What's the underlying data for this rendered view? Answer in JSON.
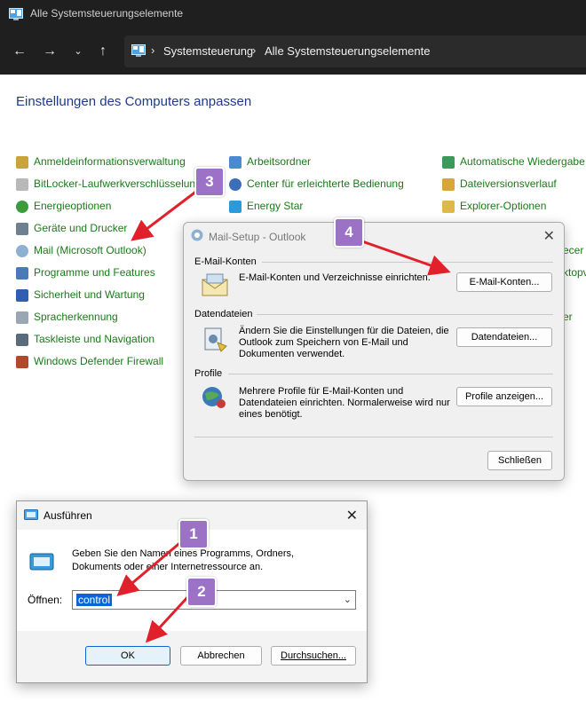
{
  "window": {
    "title": "Alle Systemsteuerungselemente",
    "breadcrumb": [
      "Systemsteuerung",
      "Alle Systemsteuerungselemente"
    ]
  },
  "content": {
    "heading": "Einstellungen des Computers anpassen",
    "col1": [
      {
        "label": "Anmeldeinformationsverwaltung",
        "icon": "credential-icon"
      },
      {
        "label": "BitLocker-Laufwerkverschlüsselun",
        "icon": "bitlocker-icon"
      },
      {
        "label": "Energieoptionen",
        "icon": "power-icon"
      },
      {
        "label": "Geräte und Drucker",
        "icon": "printer-icon"
      },
      {
        "label": "Mail (Microsoft Outlook)",
        "icon": "mail-icon"
      },
      {
        "label": "Programme und Features",
        "icon": "programs-icon"
      },
      {
        "label": "Sicherheit und Wartung",
        "icon": "flag-icon"
      },
      {
        "label": "Spracherkennung",
        "icon": "microphone-icon"
      },
      {
        "label": "Taskleiste und Navigation",
        "icon": "taskbar-icon"
      },
      {
        "label": "Windows Defender Firewall",
        "icon": "firewall-icon"
      }
    ],
    "col2": [
      {
        "label": "Arbeitsordner",
        "icon": "work-folder-icon"
      },
      {
        "label": "Center für erleichterte Bedienung",
        "icon": "accessibility-icon"
      },
      {
        "label": "Energy Star",
        "icon": "energy-star-icon"
      }
    ],
    "col3": [
      {
        "label": "Automatische Wiedergabe",
        "icon": "autoplay-icon"
      },
      {
        "label": "Dateiversionsverlauf",
        "icon": "file-history-icon"
      },
      {
        "label": "Explorer-Optionen",
        "icon": "folder-options-icon"
      }
    ],
    "partial_right": [
      "ecer",
      "ktopv",
      "er"
    ]
  },
  "mail_dialog": {
    "title": "Mail-Setup - Outlook",
    "sections": [
      {
        "title": "E-Mail-Konten",
        "text": "E-Mail-Konten und Verzeichnisse einrichten.",
        "button": "E-Mail-Konten..."
      },
      {
        "title": "Datendateien",
        "text": "Ändern Sie die Einstellungen für die Dateien, die Outlook zum Speichern von E-Mail und Dokumenten verwendet.",
        "button": "Datendateien..."
      },
      {
        "title": "Profile",
        "text": "Mehrere Profile für E-Mail-Konten und Datendateien einrichten. Normalerweise wird nur eines benötigt.",
        "button": "Profile anzeigen..."
      }
    ],
    "close_button": "Schließen"
  },
  "run_dialog": {
    "title": "Ausführen",
    "description": "Geben Sie den Namen eines Programms, Ordners, Dokuments oder einer Internetressource an.",
    "open_label": "Öffnen:",
    "input_value": "control",
    "buttons": {
      "ok": "OK",
      "cancel": "Abbrechen",
      "browse": "Durchsuchen..."
    }
  },
  "callouts": [
    "1",
    "2",
    "3",
    "4"
  ],
  "colors": {
    "link_green": "#1a7a1a",
    "heading_blue": "#1e3a8a",
    "callout": "#9b72c6",
    "arrow_red": "#e0202a"
  }
}
